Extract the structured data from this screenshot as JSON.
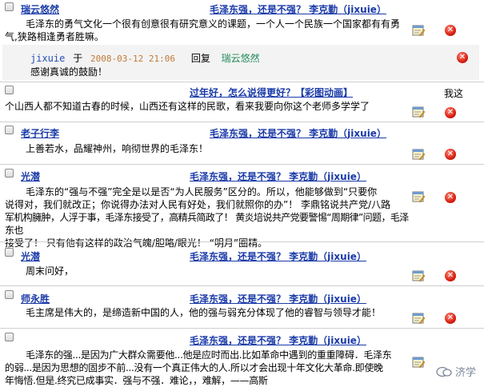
{
  "comments": [
    {
      "author": "瑞云悠然",
      "title": "毛泽东强，还是不强？ 李克勤（jixuie）",
      "body_lines": [
        "毛泽东的勇气文化一个很有创意很有研究意义的课题，一个人一个民族一个国家都有有勇",
        "气,狭路相逢勇者胜嘛。"
      ]
    },
    {
      "author": "",
      "title": "过年好，怎么说得更好？【彩图动画】",
      "extra": "我这",
      "body_lines": [
        "个山西人都不知道古春的时候，山西还有这样的民歌，看来我要向你这个老师多学学了"
      ]
    },
    {
      "author": "老子行李",
      "title": "毛泽东强，还是不强？ 李克勤（jixuie）",
      "body_lines": [
        "上善若水，品耀神州，响彻世界的毛泽东！"
      ]
    },
    {
      "author": "光潜",
      "title": "毛泽东强，还是不强？ 李克勤（jixuie）",
      "body_lines": [
        "毛泽东的“强与不强”完全是以是否“为人民服务”区分的。所以，他能够做到“只要你",
        "说得对，我们就改正；你说得办法对人民有好处，我们就照你的办”！  李鼎铭说共产党/八路",
        "军机构臃肿，人浮于事，毛泽东接受了，高精兵简政了！  黄炎培说共产党要警惕“周期律”问题，毛泽东也",
        "接受了！  只有他有这样的政治气魄/胆略/眼光！  “明月”圈精。"
      ]
    },
    {
      "author": "光潜",
      "title": "毛泽东强，还是不强？ 李克勤（jixuie）",
      "body_lines": [
        "周末问好，"
      ]
    },
    {
      "author": "师永胜",
      "title": "毛泽东强，还是不强？ 李克勤（jixuie）",
      "body_lines": [
        "毛主席是伟大的，是缔造新中国的人，他的强与弱充分体现了他的睿智与领导才能！"
      ]
    },
    {
      "author": "",
      "title": "毛泽东强，还是不强？ 李克勤（jixuie）",
      "body_lines": [
        "毛泽东的强...是因为广大群众需要他...他是应时而出.比如革命中遇到的重重障碍．毛泽东",
        "的弱...是因为思想的固步不前...没有一个真正伟大的人.所以才会出现十年文化大革命.即使晚",
        "年悔悟.但是.终究已成事实．强与不强．难论，，难解，——高斯"
      ]
    }
  ],
  "reply": {
    "name": "jixuie",
    "yu": "于",
    "date": "2008-03-12 21:06",
    "action": "回复",
    "to": "瑞云悠然",
    "text": "感谢真诚的鼓励！"
  },
  "watermark": "济学",
  "icons": {
    "edit": "edit-icon",
    "delete": "delete-icon"
  }
}
